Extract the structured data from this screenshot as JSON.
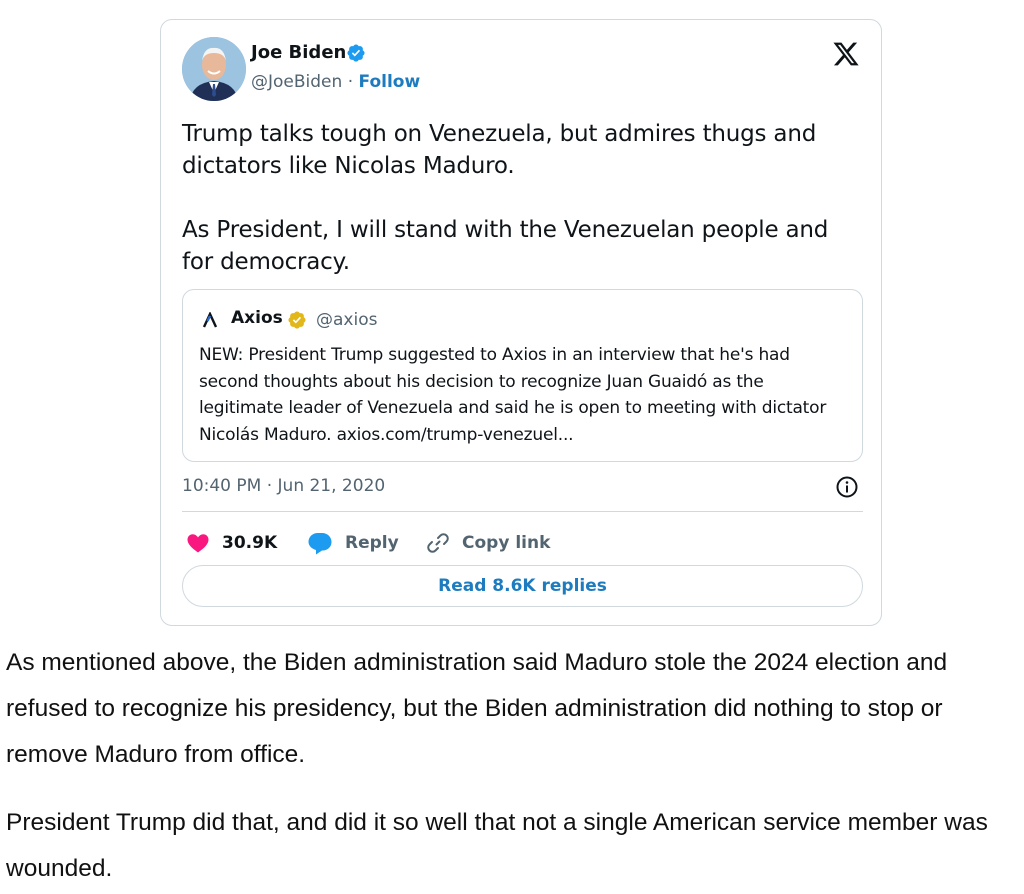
{
  "tweet": {
    "author_name": "Joe Biden",
    "handle": "@JoeBiden",
    "separator": " · ",
    "follow_label": "Follow",
    "text": "Trump talks tough on Venezuela, but admires thugs and dictators like Nicolas Maduro.\n\nAs President, I will stand with the Venezuelan people and for democracy.",
    "timestamp": "10:40 PM · Jun 21, 2020",
    "likes": "30.9K",
    "reply_label": "Reply",
    "copy_link_label": "Copy link",
    "read_replies_label": "Read 8.6K replies",
    "icons": [
      "verified-icon",
      "x-logo-icon",
      "info-icon",
      "heart-icon",
      "reply-bubble-icon",
      "link-icon"
    ],
    "colors": {
      "link_blue": "#1d7bbf",
      "heart_pink": "#f91880",
      "verified_blue": "#1d9bf0",
      "gold_badge": "#e2b719",
      "muted": "#536471",
      "border": "#cfd9de"
    }
  },
  "quoted_tweet": {
    "author_name": "Axios",
    "handle": "@axios",
    "text": "NEW: President Trump suggested to Axios in an interview that he's had second thoughts about his decision to recognize Juan Guaidó as the legitimate leader of Venezuela and said he is open to meeting with dictator Nicolás Maduro. axios.com/trump-venezuel..."
  },
  "article": {
    "paragraphs": [
      "As mentioned above, the Biden administration said Maduro stole the 2024 election and refused to recognize his presidency, but the Biden administration did nothing to stop or remove Maduro from office.",
      "President Trump did that, and did it so well that not a single American service member was wounded."
    ]
  }
}
